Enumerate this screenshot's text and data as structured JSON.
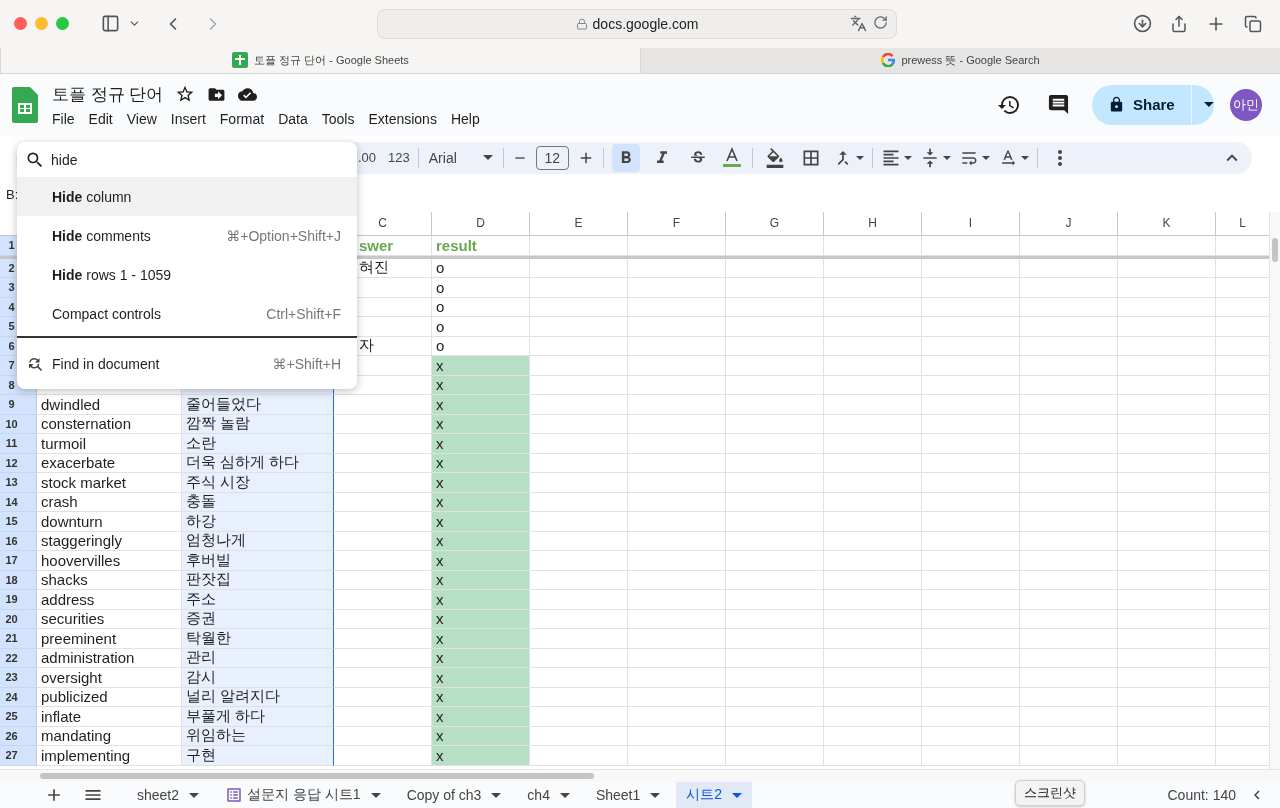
{
  "browser": {
    "url": "docs.google.com",
    "tabs": [
      {
        "title": "토플 정규 단어 - Google Sheets",
        "kind": "sheets",
        "selected": true
      },
      {
        "title": "prewess 뜻 - Google Search",
        "kind": "google",
        "selected": false
      }
    ]
  },
  "doc": {
    "title": "토플 정규 단어",
    "menu": [
      "File",
      "Edit",
      "View",
      "Insert",
      "Format",
      "Data",
      "Tools",
      "Extensions",
      "Help"
    ],
    "share": "Share",
    "avatar": "아민"
  },
  "toolbar": {
    "decimal": ".00",
    "number_format": "123",
    "font": "Arial",
    "font_size": "12",
    "bold": true
  },
  "formula_bar": {
    "name_box": "B:"
  },
  "command_menu": {
    "query": "hide",
    "items": [
      {
        "kind": "command",
        "label": "**Hide** column",
        "selected": true
      },
      {
        "kind": "command",
        "label": "**Hide** comments",
        "shortcut": "⌘+Option+Shift+J",
        "selected": false
      },
      {
        "kind": "command",
        "label": "**Hide** rows 1 - 1059",
        "selected": false
      },
      {
        "kind": "command",
        "label": "Compact controls",
        "shortcut": "Ctrl+Shift+F",
        "selected": false
      },
      {
        "kind": "find",
        "label": "Find in document",
        "shortcut": "⌘+Shift+H",
        "selected": false
      }
    ]
  },
  "sheet": {
    "columns": [
      "C",
      "D",
      "E",
      "F",
      "G",
      "H",
      "I",
      "J",
      "K",
      "L"
    ],
    "rows": [
      {
        "num": "1",
        "kind": "header",
        "answer": "swer",
        "result": "result",
        "highlighted": false
      },
      {
        "num": "2",
        "kind": "data",
        "answer": "혀진",
        "result": "o",
        "highlighted": false
      },
      {
        "num": "3",
        "kind": "data",
        "result": "o",
        "highlighted": false
      },
      {
        "num": "4",
        "kind": "data",
        "result": "o",
        "highlighted": false
      },
      {
        "num": "5",
        "kind": "data",
        "result": "o",
        "highlighted": false
      },
      {
        "num": "6",
        "kind": "data",
        "answer": "자",
        "result": "o",
        "highlighted": false
      },
      {
        "num": "7",
        "kind": "data",
        "result": "x",
        "highlighted": true
      },
      {
        "num": "8",
        "kind": "data",
        "result": "x",
        "highlighted": true
      },
      {
        "num": "9",
        "kind": "data",
        "word": "dwindled",
        "meaning": "줄어들었다",
        "result": "x",
        "highlighted": true
      },
      {
        "num": "10",
        "kind": "data",
        "word": "consternation",
        "meaning": "깜짝 놀람",
        "result": "x",
        "highlighted": true
      },
      {
        "num": "11",
        "kind": "data",
        "word": "turmoil",
        "meaning": "소란",
        "result": "x",
        "highlighted": true
      },
      {
        "num": "12",
        "kind": "data",
        "word": "exacerbate",
        "meaning": "더욱 심하게 하다",
        "result": "x",
        "highlighted": true
      },
      {
        "num": "13",
        "kind": "data",
        "word": "stock market",
        "meaning": "주식 시장",
        "result": "x",
        "highlighted": true
      },
      {
        "num": "14",
        "kind": "data",
        "word": "crash",
        "meaning": "충돌",
        "result": "x",
        "highlighted": true
      },
      {
        "num": "15",
        "kind": "data",
        "word": "downturn",
        "meaning": "하강",
        "result": "x",
        "highlighted": true
      },
      {
        "num": "16",
        "kind": "data",
        "word": "staggeringly",
        "meaning": "엄청나게",
        "result": "x",
        "highlighted": true
      },
      {
        "num": "17",
        "kind": "data",
        "word": "hoovervilles",
        "meaning": "후버빌",
        "result": "x",
        "highlighted": true
      },
      {
        "num": "18",
        "kind": "data",
        "word": "shacks",
        "meaning": "판잣집",
        "result": "x",
        "highlighted": true
      },
      {
        "num": "19",
        "kind": "data",
        "word": "address",
        "meaning": "주소",
        "result": "x",
        "highlighted": true
      },
      {
        "num": "20",
        "kind": "data",
        "word": "securities",
        "meaning": "증권",
        "result": "x",
        "highlighted": true
      },
      {
        "num": "21",
        "kind": "data",
        "word": "preeminent",
        "meaning": "탁월한",
        "result": "x",
        "highlighted": true
      },
      {
        "num": "22",
        "kind": "data",
        "word": "administration",
        "meaning": "관리",
        "result": "x",
        "highlighted": true
      },
      {
        "num": "23",
        "kind": "data",
        "word": "oversight",
        "meaning": "감시",
        "result": "x",
        "highlighted": true
      },
      {
        "num": "24",
        "kind": "data",
        "word": "publicized",
        "meaning": "널리 알려지다",
        "result": "x",
        "highlighted": true
      },
      {
        "num": "25",
        "kind": "data",
        "word": "inflate",
        "meaning": "부풀게 하다",
        "result": "x",
        "highlighted": true
      },
      {
        "num": "26",
        "kind": "data",
        "word": "mandating",
        "meaning": "위임하는",
        "result": "x",
        "highlighted": true
      },
      {
        "num": "27",
        "kind": "data",
        "word": "implementing",
        "meaning": "구현",
        "result": "x",
        "highlighted": true
      }
    ]
  },
  "sheet_tabs": [
    {
      "label": "sheet2",
      "kind": "sheet",
      "selected": false
    },
    {
      "label": "설문지 응답 시트1",
      "kind": "form",
      "selected": false
    },
    {
      "label": "Copy of ch3",
      "kind": "sheet",
      "selected": false
    },
    {
      "label": "ch4",
      "kind": "sheet",
      "selected": false
    },
    {
      "label": "Sheet1",
      "kind": "sheet",
      "selected": false
    },
    {
      "label": "시트2",
      "kind": "sheet",
      "selected": true
    }
  ],
  "tooltip": "스크린샷",
  "status": "Count: 140"
}
